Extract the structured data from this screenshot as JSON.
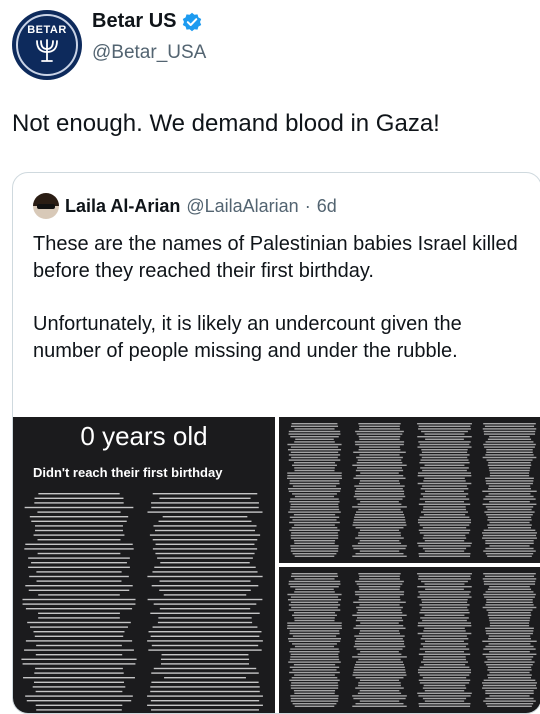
{
  "author": {
    "display_name": "Betar US",
    "handle": "@Betar_USA",
    "avatar_text": "BETAR",
    "verified_color": "#1d9bf0"
  },
  "tweet": {
    "text": "Not enough. We demand blood in Gaza!"
  },
  "quoted": {
    "display_name": "Laila Al-Arian",
    "handle": "@LailaAlarian",
    "separator": "·",
    "time": "6d",
    "paragraphs": [
      "These are the names of Palestinian babies Israel killed before they reached their first birthday.",
      "Unfortunately, it is likely an undercount given the number of people missing and under the rubble."
    ]
  },
  "media": {
    "main_title": "0 years old",
    "main_subtitle": "Didn't reach their first birthday"
  },
  "colors": {
    "text": "#0f1419",
    "secondary": "#536471",
    "border": "#cfd9de",
    "image_bg": "#1b1b1d",
    "avatar_bg": "#0d2a5c"
  }
}
